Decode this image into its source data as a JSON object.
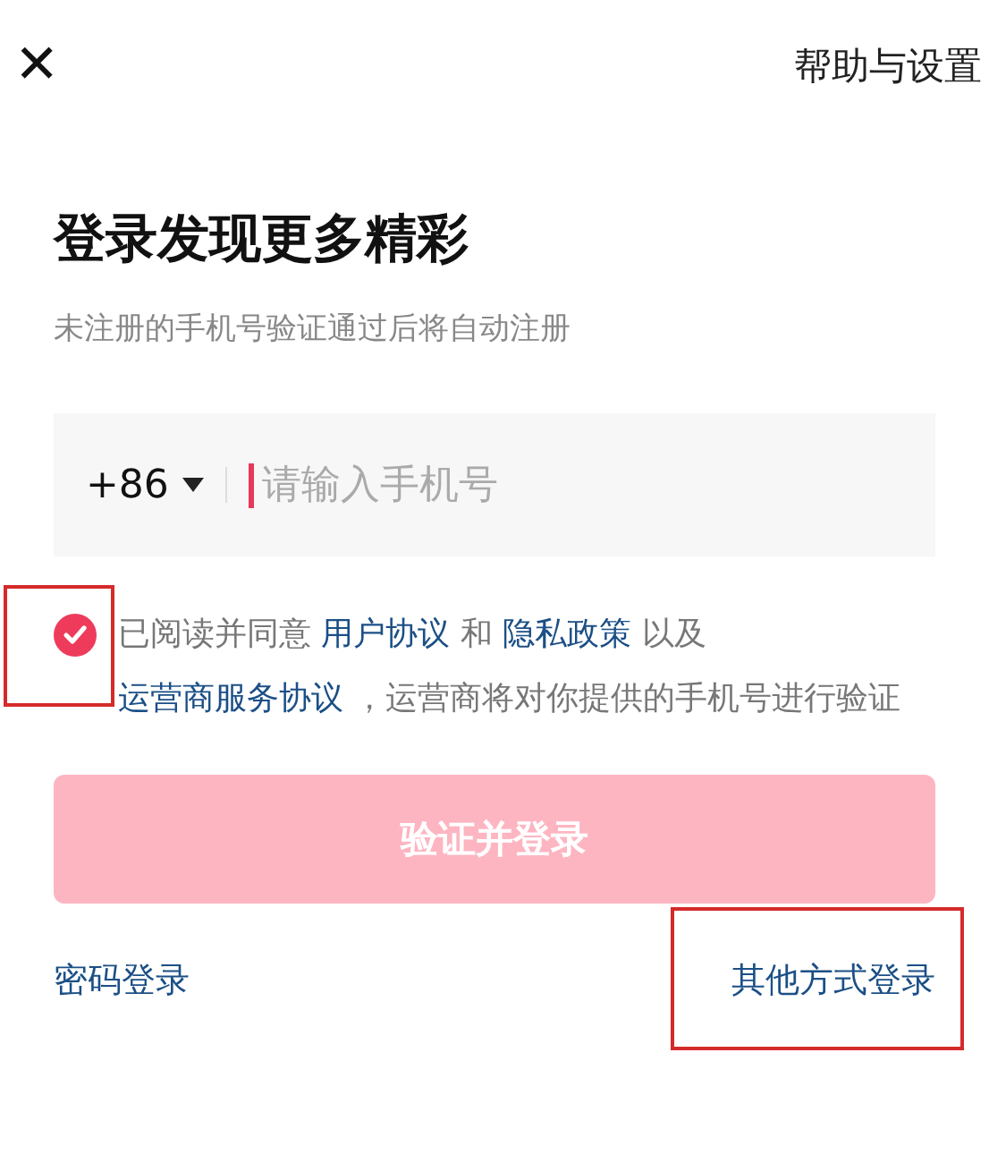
{
  "close_button": {
    "glyph": "✕"
  },
  "help_link": "帮助与设置",
  "title": "登录发现更多精彩",
  "subtitle": "未注册的手机号验证通过后将自动注册",
  "phone_field": {
    "country_code": "+86",
    "placeholder": "请输入手机号",
    "focused": true
  },
  "agreement": {
    "checked": true,
    "highlighted": true,
    "parts": [
      {
        "text": "已阅读并同意 ",
        "link": false
      },
      {
        "text": "用户协议",
        "link": true
      },
      {
        "text": " 和 ",
        "link": false
      },
      {
        "text": "隐私政策",
        "link": true
      },
      {
        "text": " 以及 ",
        "link": false
      },
      {
        "text": "运营商服务协议",
        "link": true
      },
      {
        "text": " ，运营商将对你提供的手机号进行验证",
        "link": false
      }
    ]
  },
  "submit_button": {
    "label": "验证并登录",
    "disabled": true
  },
  "footer_links": [
    {
      "label": "密码登录",
      "highlighted": false
    },
    {
      "label": "其他方式登录",
      "highlighted": true
    }
  ]
}
